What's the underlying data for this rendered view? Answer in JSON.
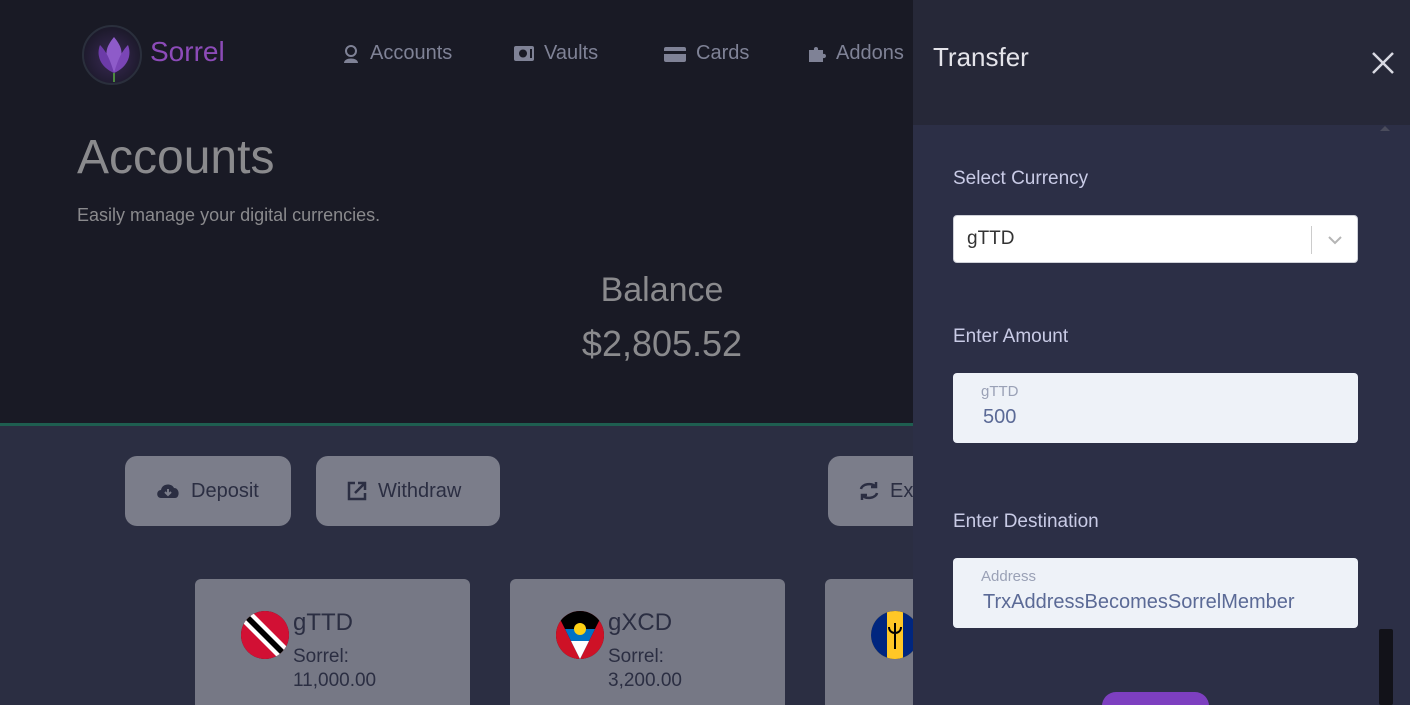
{
  "brand": {
    "name": "Sorrel"
  },
  "nav": [
    {
      "label": "Accounts",
      "icon": "user-badge-icon"
    },
    {
      "label": "Vaults",
      "icon": "vault-icon"
    },
    {
      "label": "Cards",
      "icon": "card-icon"
    },
    {
      "label": "Addons",
      "icon": "puzzle-icon"
    }
  ],
  "page": {
    "title": "Accounts",
    "subtitle": "Easily manage your digital currencies.",
    "balance_label": "Balance",
    "balance_value": "$2,805.52"
  },
  "actions": {
    "deposit": "Deposit",
    "withdraw": "Withdraw",
    "exchange": "Ex"
  },
  "cards": [
    {
      "code": "gTTD",
      "label": "Sorrel:",
      "amount": "11,000.00",
      "flag": "trinidad-and-tobago-flag"
    },
    {
      "code": "gXCD",
      "label": "Sorrel:",
      "amount": "3,200.00",
      "flag": "antigua-and-barbuda-flag"
    },
    {
      "code": "",
      "label": "",
      "amount": "",
      "flag": "barbados-flag"
    }
  ],
  "drawer": {
    "title": "Transfer",
    "currency_label": "Select Currency",
    "currency_value": "gTTD",
    "amount_label": "Enter Amount",
    "amount_placeholder": "gTTD",
    "amount_value": "500",
    "destination_label": "Enter Destination",
    "destination_placeholder": "Address",
    "destination_value": "TrxAddressBecomesSorrelMember"
  },
  "colors": {
    "brand": "#8c4bb8",
    "drawer_bg": "#2c2f46",
    "submit": "#7d3fc0"
  }
}
